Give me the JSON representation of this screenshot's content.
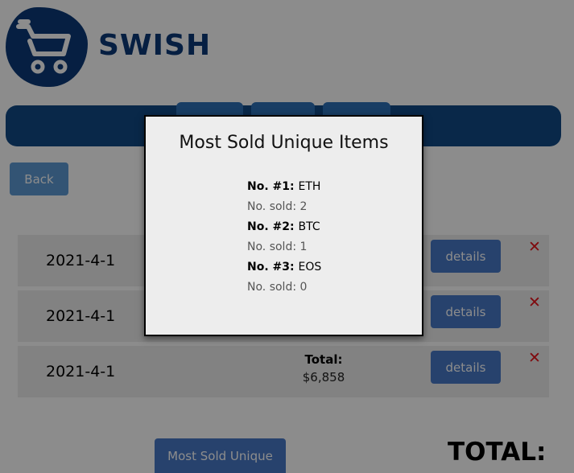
{
  "brand": {
    "name": "SWISH"
  },
  "nav": {
    "tabs": [
      "",
      "",
      ""
    ]
  },
  "back_label": "Back",
  "orders": [
    {
      "date": "2021-4-1",
      "total_label": "",
      "total_value": "",
      "details_label": "details"
    },
    {
      "date": "2021-4-1",
      "total_label": "",
      "total_value": "",
      "details_label": "details"
    },
    {
      "date": "2021-4-1",
      "total_label": "Total:",
      "total_value": "$6,858",
      "details_label": "details"
    }
  ],
  "most_sold_button": "Most Sold Unique",
  "grand_total_label": "TOTAL:",
  "modal": {
    "title": "Most Sold Unique Items",
    "items": [
      {
        "rank": "No. #1:",
        "name": "ETH",
        "sold": "No. sold: 2"
      },
      {
        "rank": "No. #2:",
        "name": "BTC",
        "sold": "No. sold: 1"
      },
      {
        "rank": "No. #3:",
        "name": "EOS",
        "sold": "No. sold: 0"
      }
    ]
  },
  "colors": {
    "brand": "#0b3a78",
    "navbar": "#114a86",
    "button": "#4879c7",
    "delete": "#e8141c",
    "overlay": "rgba(0,0,0,0.45)"
  },
  "icons": {
    "logo": "shopping-cart-icon",
    "delete": "close-icon"
  }
}
